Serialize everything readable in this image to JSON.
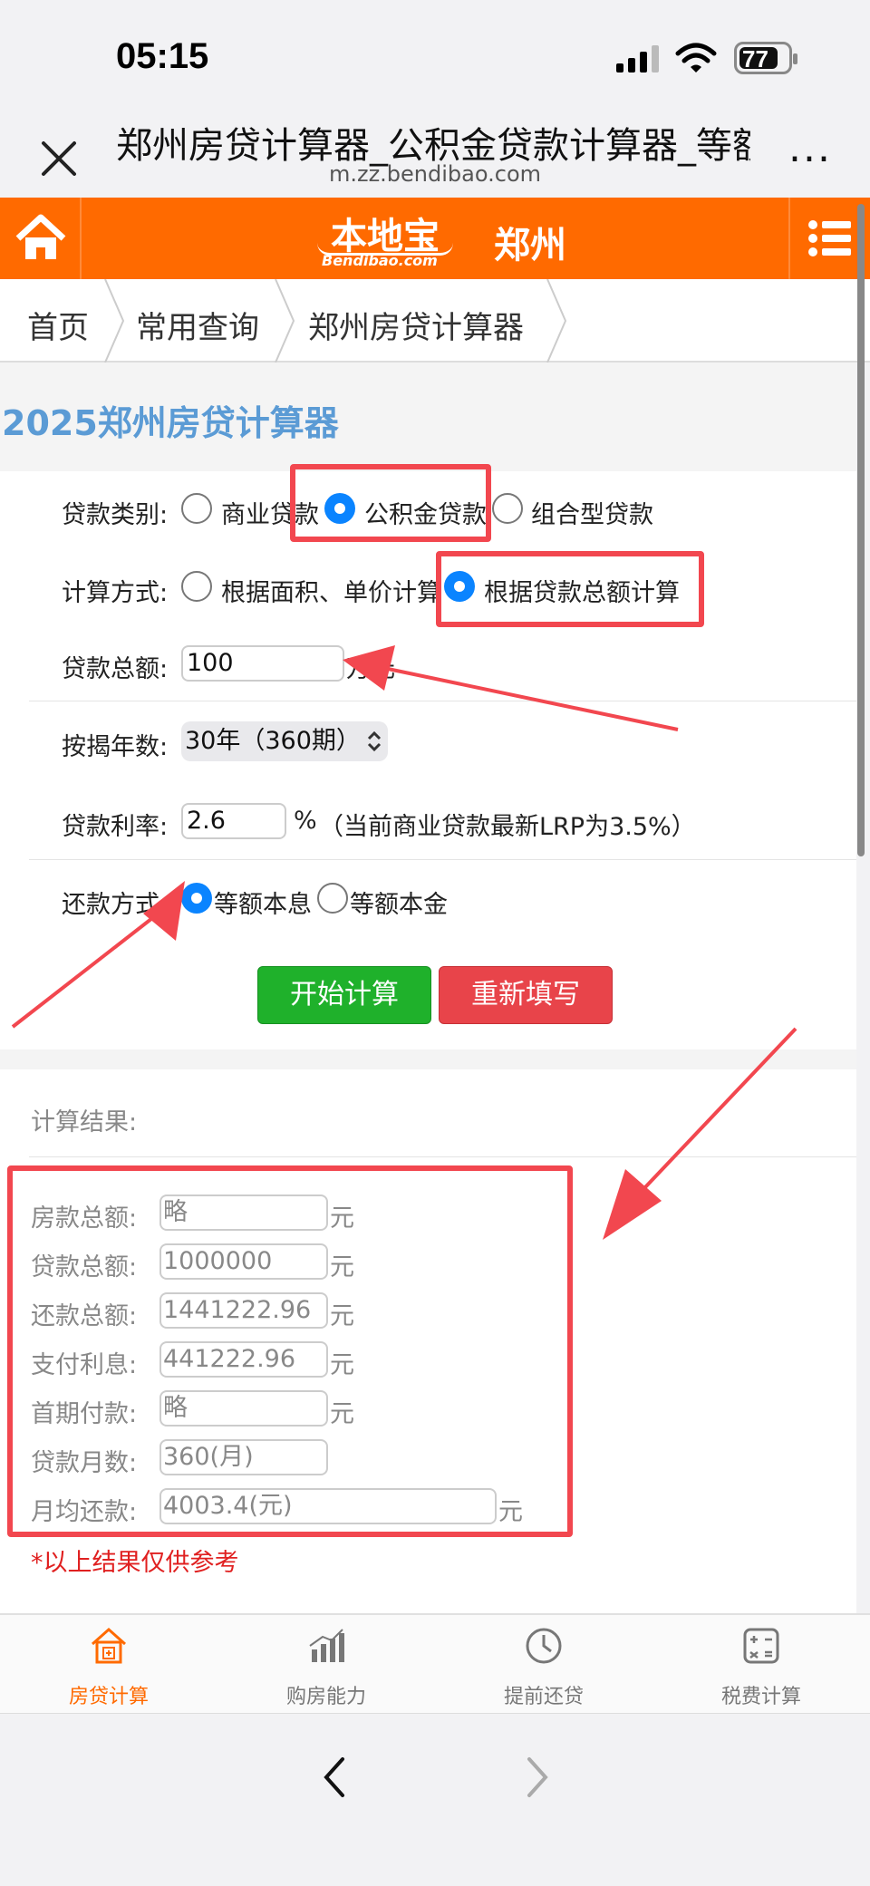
{
  "status_bar": {
    "time": "05:15",
    "battery": "77"
  },
  "browser": {
    "title": "郑州房贷计算器_公积金贷款计算器_等额本息",
    "url": "m.zz.bendibao.com",
    "more": "..."
  },
  "site": {
    "logo_text": "本地宝",
    "logo_sub": "Bendibao.com",
    "city": "郑州"
  },
  "breadcrumb": [
    "首页",
    "常用查询",
    "郑州房贷计算器"
  ],
  "page_heading": "2025郑州房贷计算器",
  "form": {
    "loan_type": {
      "label": "贷款类别:",
      "options": [
        "商业贷款",
        "公积金贷款",
        "组合型贷款"
      ],
      "selected": "公积金贷款"
    },
    "calc_method": {
      "label": "计算方式:",
      "options": [
        "根据面积、单价计算",
        "根据贷款总额计算"
      ],
      "selected": "根据贷款总额计算"
    },
    "loan_amount": {
      "label": "贷款总额:",
      "value": "100",
      "unit": "万元"
    },
    "years": {
      "label": "按揭年数:",
      "value": "30年（360期）"
    },
    "rate": {
      "label": "贷款利率:",
      "value": "2.6",
      "unit": "%",
      "note": "（当前商业贷款最新LRP为3.5%）"
    },
    "repay_method": {
      "label": "还款方式:",
      "options": [
        "等额本息",
        "等额本金"
      ],
      "selected": "等额本息"
    },
    "buttons": {
      "calculate": "开始计算",
      "reset": "重新填写"
    }
  },
  "results": {
    "title": "计算结果:",
    "rows": [
      {
        "label": "房款总额:",
        "value": "略",
        "unit": "元"
      },
      {
        "label": "贷款总额:",
        "value": "1000000",
        "unit": "元"
      },
      {
        "label": "还款总额:",
        "value": "1441222.96",
        "unit": "元"
      },
      {
        "label": "支付利息:",
        "value": "441222.96",
        "unit": "元"
      },
      {
        "label": "首期付款:",
        "value": "略",
        "unit": "元"
      },
      {
        "label": "贷款月数:",
        "value": "360(月)",
        "unit": ""
      },
      {
        "label": "月均还款:",
        "value": "4003.4(元)",
        "unit": "元"
      }
    ],
    "note": "*以上结果仅供参考"
  },
  "tabbar": {
    "active": "房贷计算",
    "items": [
      {
        "label": "房贷计算",
        "icon": "house-calculator-icon"
      },
      {
        "label": "购房能力",
        "icon": "bar-chart-icon"
      },
      {
        "label": "提前还贷",
        "icon": "clock-icon"
      },
      {
        "label": "税费计算",
        "icon": "calculator-icon"
      }
    ]
  },
  "colors": {
    "brand_orange": "#ff6a00",
    "heading_blue": "#5b9bd5",
    "radio_blue": "#0a84ff",
    "highlight_red": "#f2474f",
    "button_green": "#1fb12b",
    "button_red": "#e8444a"
  }
}
